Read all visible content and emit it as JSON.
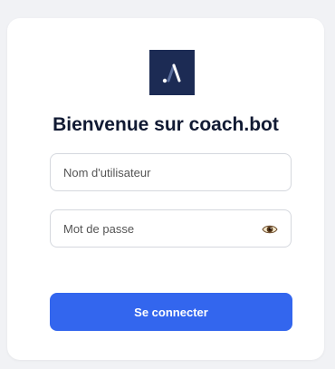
{
  "brand": {
    "logo_icon": "coach-bot-logo-icon",
    "logo_bg": "#1c2b54"
  },
  "login": {
    "title": "Bienvenue sur coach.bot",
    "username_placeholder": "Nom d'utilisateur",
    "username_value": "",
    "password_placeholder": "Mot de passe",
    "password_value": "",
    "show_password_icon": "eye-icon",
    "submit_label": "Se connecter",
    "accent_color": "#3366ee"
  }
}
